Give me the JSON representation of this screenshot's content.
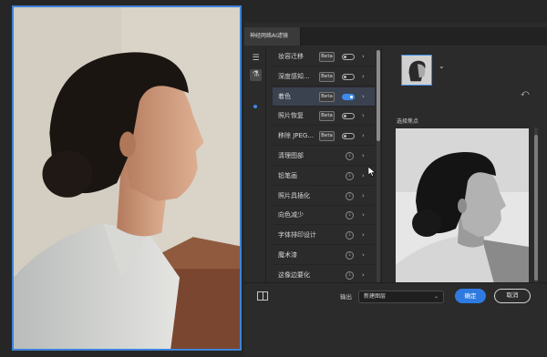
{
  "panel": {
    "tab_title": "神经网络AI滤镜"
  },
  "toolstrip": {
    "icons": [
      "sliders-icon",
      "flask-icon"
    ]
  },
  "filters": [
    {
      "label": "妆容迁移",
      "kind": "beta",
      "badge": "Beta",
      "enabled": false
    },
    {
      "label": "深度感知...",
      "kind": "beta",
      "badge": "Beta",
      "enabled": false
    },
    {
      "label": "着色",
      "kind": "beta",
      "badge": "Beta",
      "enabled": true,
      "selected": true
    },
    {
      "label": "照片恢复",
      "kind": "beta",
      "badge": "Beta",
      "enabled": false
    },
    {
      "label": "移除 JPEG...",
      "kind": "beta",
      "badge": "Beta",
      "enabled": false
    },
    {
      "label": "清理图部",
      "kind": "download"
    },
    {
      "label": "铅笔画",
      "kind": "download"
    },
    {
      "label": "照片具插化",
      "kind": "download"
    },
    {
      "label": "向色减少",
      "kind": "download"
    },
    {
      "label": "字体排印设计",
      "kind": "download"
    },
    {
      "label": "魔术漆",
      "kind": "download"
    },
    {
      "label": "这像边要化",
      "kind": "download"
    }
  ],
  "preview": {
    "label": "选择焦点"
  },
  "footer": {
    "output_label": "输出",
    "output_value": "新建图层",
    "ok_label": "确定",
    "cancel_label": "取消"
  },
  "colors": {
    "accent": "#2f7ae0",
    "selection_border": "#3d82d8"
  }
}
